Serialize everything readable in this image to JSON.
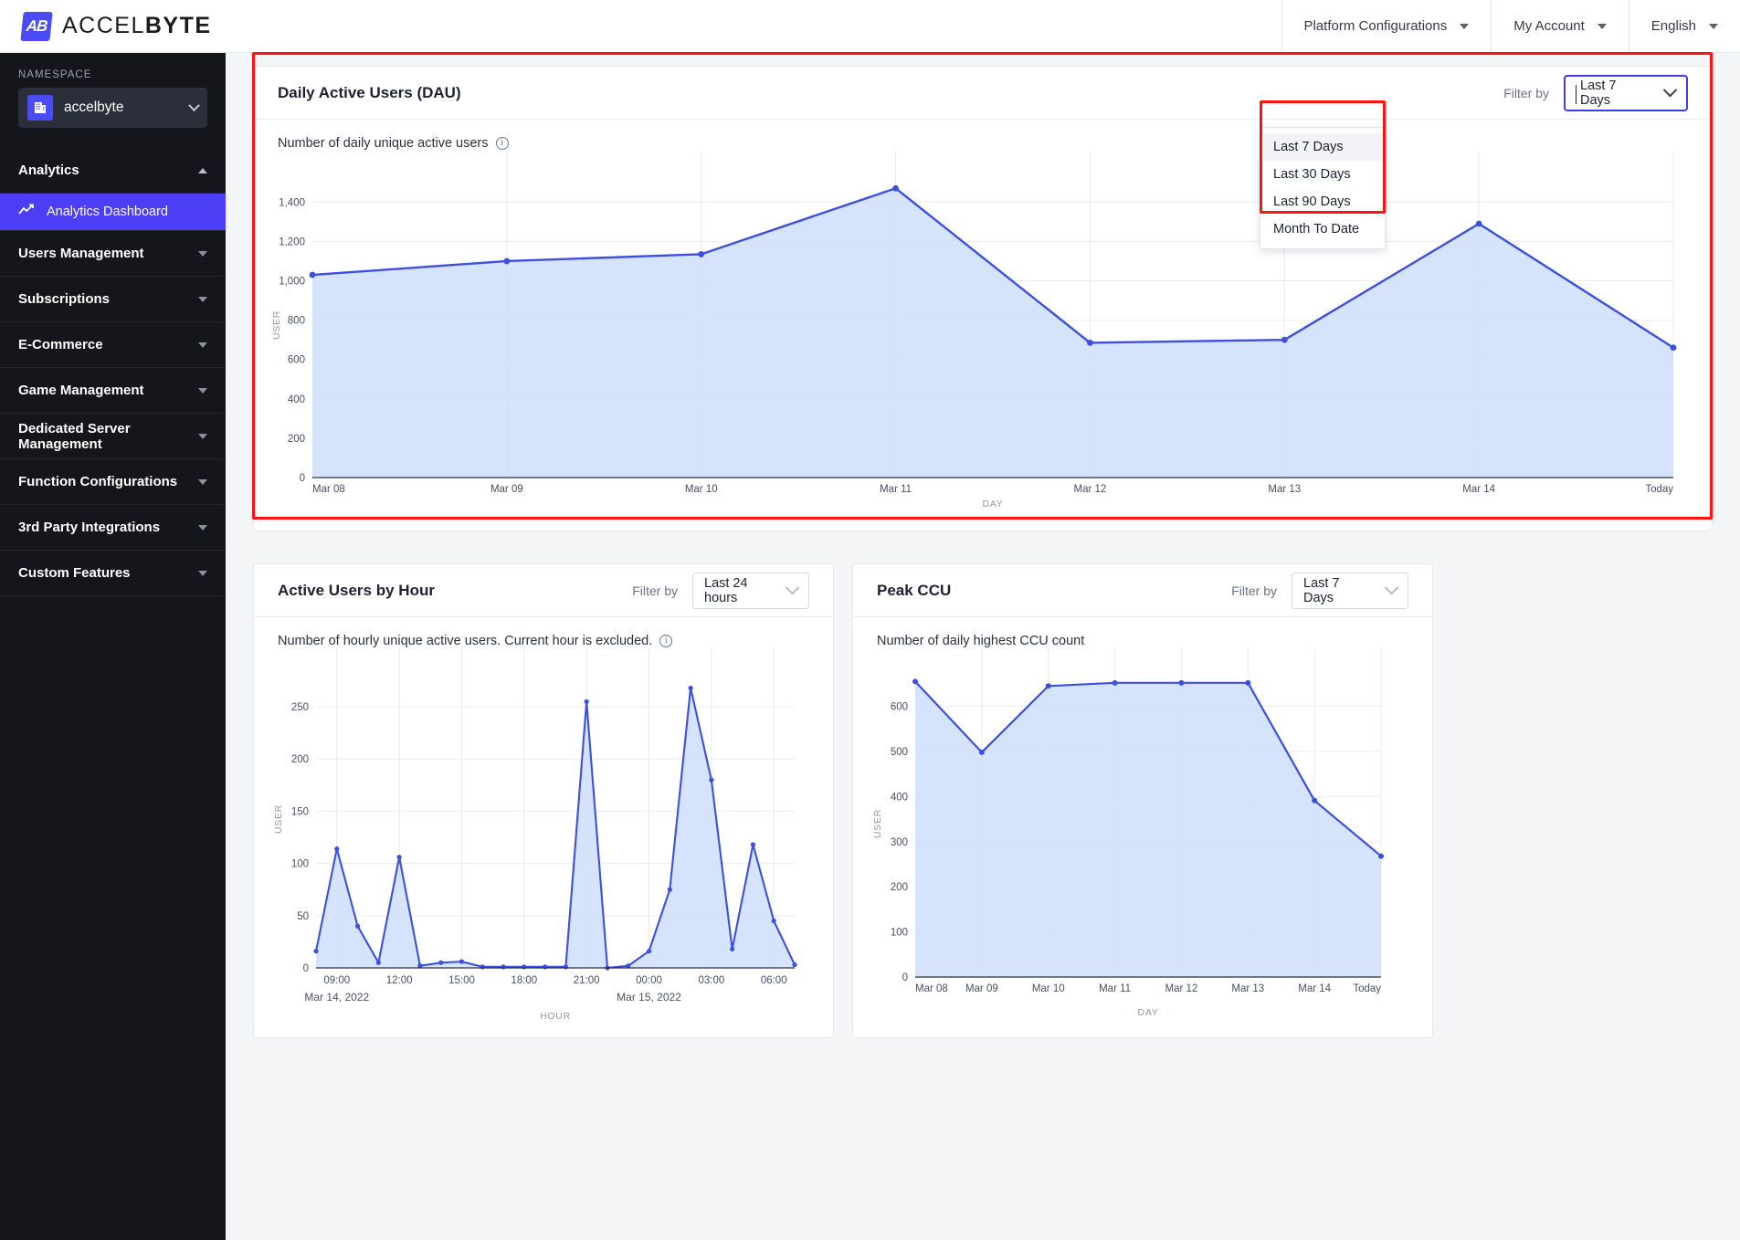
{
  "header": {
    "brand_prefix": "ACCEL",
    "brand_suffix": "BYTE",
    "brand_mark": "AB",
    "menu": [
      {
        "label": "Platform Configurations",
        "icon": "chevron-down-icon"
      },
      {
        "label": "My Account",
        "icon": "chevron-down-icon"
      },
      {
        "label": "English",
        "icon": "chevron-down-icon"
      }
    ]
  },
  "sidebar": {
    "namespace_label": "NAMESPACE",
    "namespace_value": "accelbyte",
    "namespace_icon": "building-icon",
    "groups": [
      {
        "label": "Analytics",
        "expanded": true,
        "icon": "chevron-up-icon"
      },
      {
        "label": "Users Management",
        "expanded": false,
        "icon": "chevron-down-icon"
      },
      {
        "label": "Subscriptions",
        "expanded": false,
        "icon": "chevron-down-icon"
      },
      {
        "label": "E-Commerce",
        "expanded": false,
        "icon": "chevron-down-icon"
      },
      {
        "label": "Game Management",
        "expanded": false,
        "icon": "chevron-down-icon"
      },
      {
        "label": "Dedicated Server Management",
        "expanded": false,
        "icon": "chevron-down-icon"
      },
      {
        "label": "Function Configurations",
        "expanded": false,
        "icon": "chevron-down-icon"
      },
      {
        "label": "3rd Party Integrations",
        "expanded": false,
        "icon": "chevron-down-icon"
      },
      {
        "label": "Custom Features",
        "expanded": false,
        "icon": "chevron-down-icon"
      }
    ],
    "analytics_items": [
      {
        "label": "Analytics Dashboard",
        "icon": "trending-up-icon",
        "active": true
      }
    ]
  },
  "dau_card": {
    "title": "Daily Active Users (DAU)",
    "filter_label": "Filter by",
    "filter_value": "Last 7 Days",
    "filter_icon": "chevron-down-icon",
    "caption": "Number of daily unique active users",
    "caption_icon": "info-icon",
    "dropdown_open": true,
    "dropdown_options": [
      "Last 7 Days",
      "Last 30 Days",
      "Last 90 Days",
      "Month To Date"
    ],
    "dropdown_selected": "Last 7 Days"
  },
  "hour_card": {
    "title": "Active Users by Hour",
    "filter_label": "Filter by",
    "filter_value": "Last 24 hours",
    "filter_icon": "chevron-down-icon",
    "caption": "Number of hourly unique active users. Current hour is excluded.",
    "caption_icon": "info-icon"
  },
  "ccu_card": {
    "title": "Peak CCU",
    "filter_label": "Filter by",
    "filter_value": "Last 7 Days",
    "filter_icon": "chevron-down-icon",
    "caption": "Number of daily highest CCU count"
  },
  "colors": {
    "accent": "#4b3ef5",
    "line": "#3b4fe0",
    "area": "#cfdefb",
    "highlight": "#ff1212",
    "sidebar_bg": "#14161c"
  },
  "chart_data": [
    {
      "id": "dau",
      "type": "area",
      "title": "Number of daily unique active users",
      "xlabel": "DAY",
      "ylabel": "USER",
      "categories": [
        "Mar 08",
        "Mar 09",
        "Mar 10",
        "Mar 11",
        "Mar 12",
        "Mar 13",
        "Mar 14",
        "Today"
      ],
      "values": [
        1030,
        1100,
        1135,
        1470,
        685,
        700,
        1290,
        660
      ],
      "yticks": [
        0,
        200,
        400,
        600,
        800,
        1000,
        1200,
        1400
      ],
      "ylim": [
        0,
        1550
      ],
      "grid": true,
      "legend": "none"
    },
    {
      "id": "active_users_by_hour",
      "type": "area",
      "title": "Number of hourly unique active users. Current hour is excluded.",
      "xlabel": "HOUR",
      "ylabel": "USER",
      "x_tick_labels": [
        "09:00",
        "12:00",
        "15:00",
        "18:00",
        "21:00",
        "00:00",
        "03:00",
        "06:00"
      ],
      "x_date_labels": [
        "Mar 14, 2022",
        "Mar 15, 2022"
      ],
      "categories": [
        "08:00",
        "09:00",
        "10:00",
        "11:00",
        "12:00",
        "13:00",
        "14:00",
        "15:00",
        "16:00",
        "17:00",
        "18:00",
        "19:00",
        "20:00",
        "21:00",
        "22:00",
        "23:00",
        "00:00",
        "01:00",
        "02:00",
        "03:00",
        "04:00",
        "05:00",
        "06:00",
        "07:00"
      ],
      "values": [
        16,
        114,
        40,
        5,
        106,
        2,
        5,
        6,
        1,
        1,
        1,
        1,
        1,
        255,
        0,
        2,
        16,
        75,
        268,
        180,
        18,
        118,
        45,
        3
      ],
      "yticks": [
        0,
        50,
        100,
        150,
        200,
        250
      ],
      "ylim": [
        0,
        285
      ],
      "grid": true,
      "legend": "none"
    },
    {
      "id": "peak_ccu",
      "type": "area",
      "title": "Number of daily highest CCU count",
      "xlabel": "DAY",
      "ylabel": "USER",
      "categories": [
        "Mar 08",
        "Mar 09",
        "Mar 10",
        "Mar 11",
        "Mar 12",
        "Mar 13",
        "Mar 14",
        "Today"
      ],
      "values": [
        655,
        498,
        645,
        652,
        652,
        652,
        391,
        268
      ],
      "yticks": [
        0,
        100,
        200,
        300,
        400,
        500,
        600
      ],
      "ylim": [
        0,
        680
      ],
      "grid": true,
      "legend": "none"
    }
  ]
}
